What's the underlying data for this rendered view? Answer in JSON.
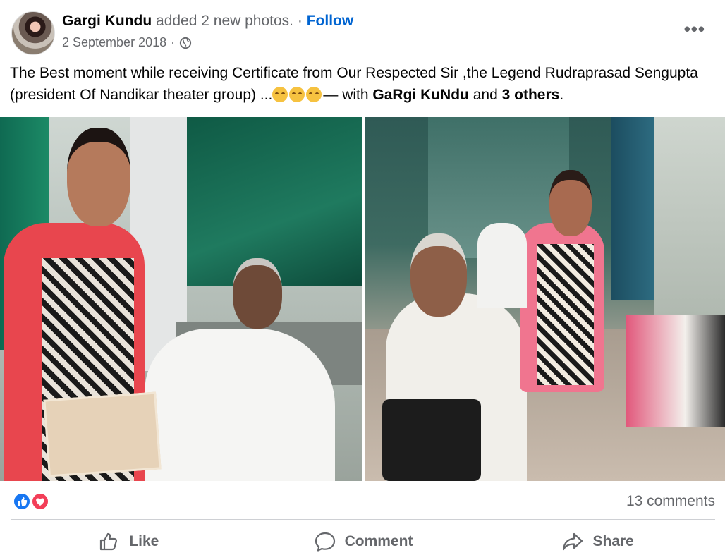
{
  "post": {
    "author": "Gargi Kundu",
    "action_text": "added 2 new photos.",
    "separator": "·",
    "follow_label": "Follow",
    "date": "2 September 2018",
    "date_separator": "·",
    "privacy_icon": "globe-icon",
    "more_icon": "more-options-icon",
    "more_glyph": "•••",
    "caption": {
      "text": "The Best moment while receiving Certificate from Our Respected  Sir ,the Legend Rudraprasad Sengupta (president Of Nandikar theater group) ...",
      "emoji_count": 3,
      "with_text": "— with",
      "tagged_person": "GaRgi KuNdu",
      "and_text": "and",
      "others": "3 others",
      "end": "."
    },
    "photos": [
      "certificate-photo-left",
      "certificate-photo-right"
    ]
  },
  "stats": {
    "reactions": [
      "like-reaction-icon",
      "love-reaction-icon"
    ],
    "comments": "13 comments"
  },
  "actions": {
    "like": "Like",
    "comment": "Comment",
    "share": "Share"
  },
  "colors": {
    "link": "#0064d1",
    "muted": "#65676b",
    "like_blue": "#1877f2",
    "love_red": "#f33e58"
  }
}
